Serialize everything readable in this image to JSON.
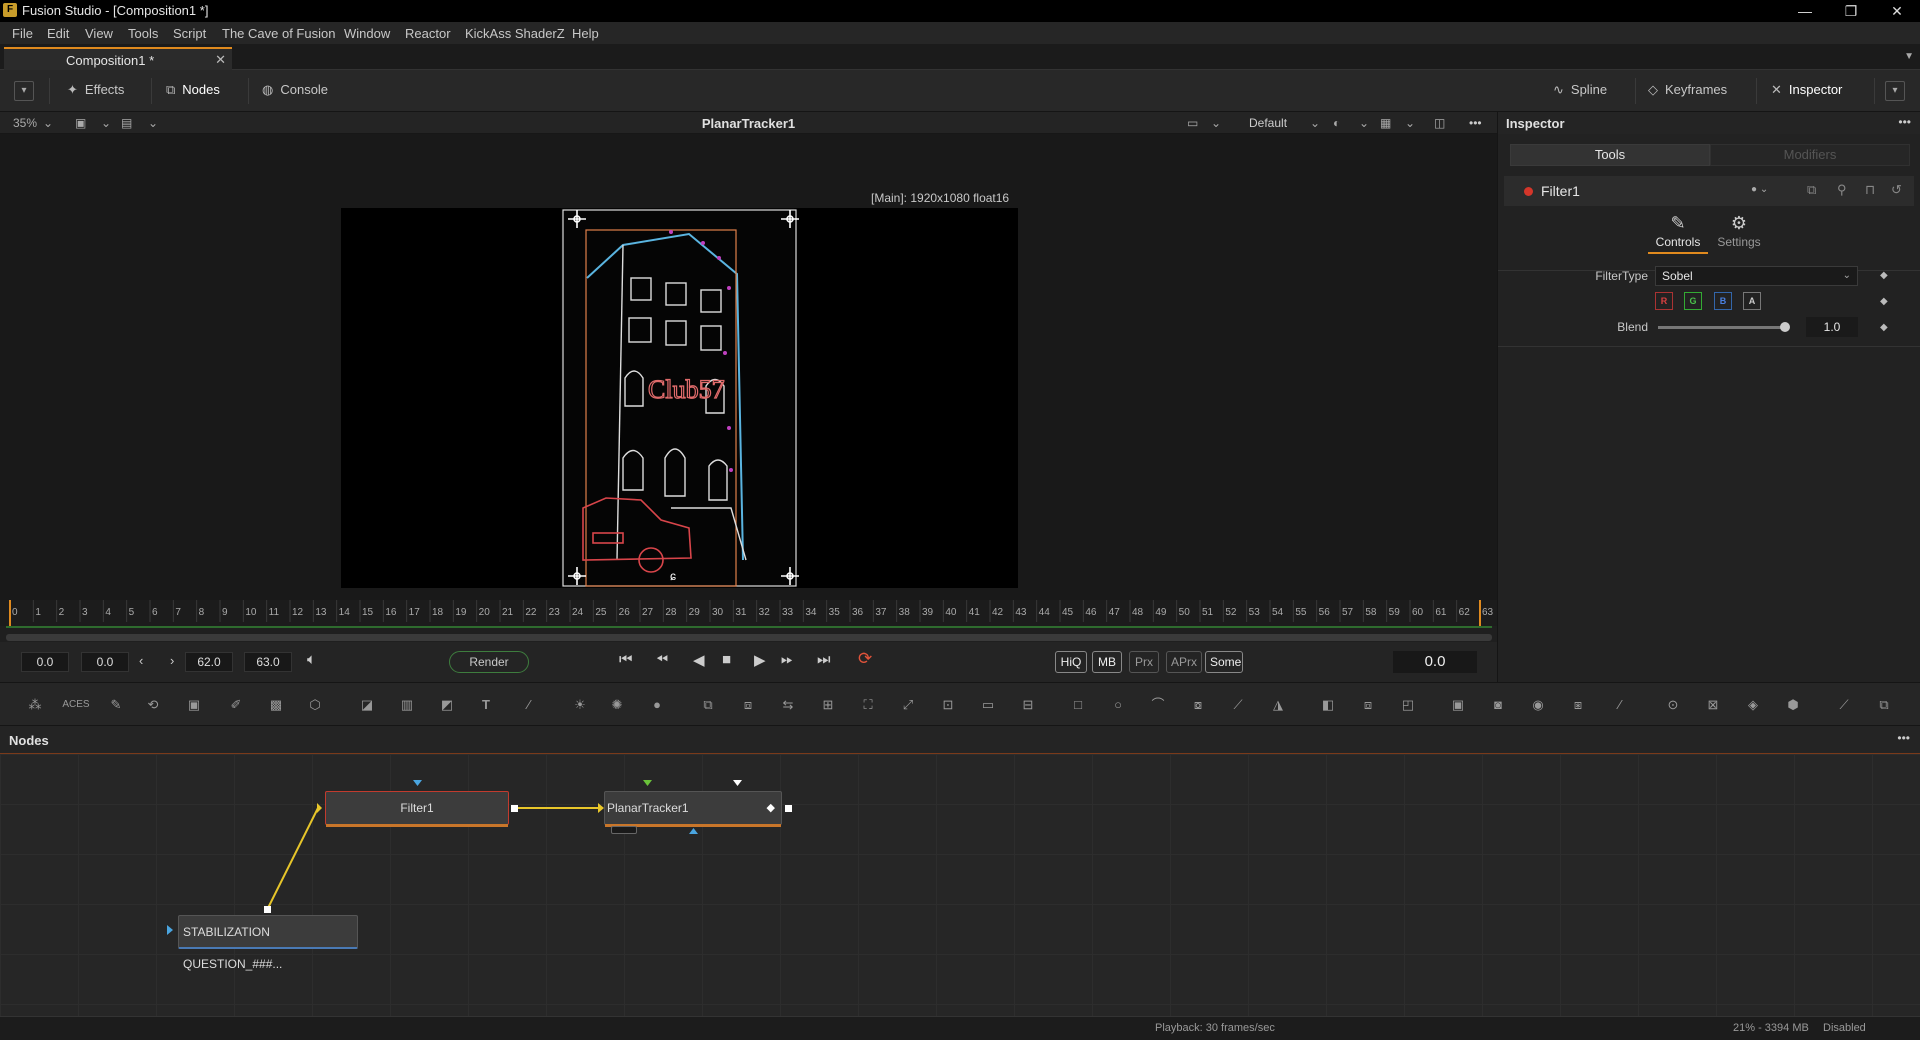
{
  "window": {
    "title": "Fusion Studio - [Composition1 *]",
    "minimize": "—",
    "maximize": "❐",
    "close": "✕"
  },
  "menu": [
    "File",
    "Edit",
    "View",
    "Tools",
    "Script",
    "The Cave of Fusion",
    "Window",
    "Reactor",
    "KickAss ShaderZ",
    "Help"
  ],
  "doc_tab": {
    "label": "Composition1 *",
    "close": "✕"
  },
  "toolbar_top": {
    "effects": "Effects",
    "nodes": "Nodes",
    "console": "Console",
    "spline": "Spline",
    "keyframes": "Keyframes",
    "inspector": "Inspector"
  },
  "viewer": {
    "zoom": "35%",
    "title": "PlanarTracker1",
    "lut": "Default",
    "image_info": "[Main]: 1920x1080 float16",
    "ruler_start": 0,
    "ruler_end": 63
  },
  "transport": {
    "global_start": "0.0",
    "render_start": "0.0",
    "render_end": "62.0",
    "global_end": "63.0",
    "render": "Render",
    "hiq": "HiQ",
    "mb": "MB",
    "prx": "Prx",
    "aprx": "APrx",
    "some": "Some",
    "current_frame": "0.0"
  },
  "nodes_panel": {
    "title": "Nodes",
    "nodes": [
      {
        "name": "Filter1"
      },
      {
        "name": "PlanarTracker1"
      },
      {
        "name": "STABILIZATION QUESTION_###..."
      }
    ]
  },
  "inspector": {
    "title": "Inspector",
    "tab_tools": "Tools",
    "tab_modifiers": "Modifiers",
    "tool_name": "Filter1",
    "subtab_controls": "Controls",
    "subtab_settings": "Settings",
    "filter_type_label": "FilterType",
    "filter_type_value": "Sobel",
    "channels": [
      "R",
      "G",
      "B",
      "A"
    ],
    "blend_label": "Blend",
    "blend_value": "1.0",
    "blend_level": 1.0
  },
  "status": {
    "playback": "Playback: 30 frames/sec",
    "memory": "21% - 3394 MB",
    "state": "Disabled"
  },
  "colors": {
    "accent_orange": "#e08a1e",
    "selected_red": "#c23b2e",
    "render_green": "#3e7d3e",
    "link_yellow": "#e8c62a"
  }
}
